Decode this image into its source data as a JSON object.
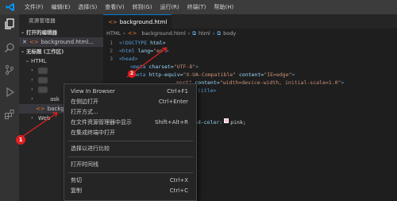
{
  "menu": [
    "文件(F)",
    "编辑(E)",
    "选择(S)",
    "查看(V)",
    "转到(G)",
    "运行(R)",
    "终端(T)",
    "帮助(H)"
  ],
  "sidebar": {
    "title": "资源管理器",
    "open_editors_header": "打开的编辑器",
    "open_file": "background.html...",
    "workspace_header": "无标题 (工作区)",
    "folder": "HTML",
    "items": [
      "",
      "",
      "",
      "ask",
      "backg",
      "Web"
    ],
    "file_badge": "<>"
  },
  "editor": {
    "tab_label": "background.html",
    "breadcrumb": [
      "HTML",
      "background.html",
      "html",
      "body"
    ],
    "line_numbers": [
      "1",
      "2",
      "3"
    ]
  },
  "code": {
    "doctype": "<!DOCTYPE",
    "doctype_rest": " html>",
    "html_open": "<html",
    "lang_attr": " lang=",
    "lang_val": "\"en\"",
    "gt": ">",
    "head_open": "<head>",
    "meta_open": "<meta",
    "charset_attr": " charset=",
    "charset_val": "\"UTF-8\"",
    "meta_close": ">",
    "http_attr": " http-equiv=",
    "http_val": "\"X-UA-Compatible\"",
    "content_attr": " content=",
    "content_val": "\"IE=edge\"",
    "viewport_val": "port\"",
    "content_attr2": " content=",
    "viewport_content": "\"width=device-width, initial-scale=1.0\"",
    "title_close": "/title>",
    "css_prop": "nd-color:",
    "css_value": "pink;"
  },
  "context_menu": {
    "items": [
      {
        "label": "View In Browser",
        "shortcut": "Ctrl+F1"
      },
      {
        "label": "在侧边打开",
        "shortcut": "Ctrl+Enter"
      },
      {
        "label": "打开方式...",
        "shortcut": ""
      },
      {
        "label": "在文件资源管理器中显示",
        "shortcut": "Shift+Alt+R"
      },
      {
        "label": "在集成终端中打开",
        "shortcut": ""
      },
      {
        "label": "选择以进行比较",
        "shortcut": ""
      },
      {
        "label": "打开时间线",
        "shortcut": ""
      },
      {
        "label": "剪切",
        "shortcut": "Ctrl+X"
      },
      {
        "label": "复制",
        "shortcut": "Ctrl+C"
      }
    ]
  },
  "markers": {
    "first": "1",
    "second": "2"
  },
  "colors": {
    "accent": "#0078d4",
    "marker": "#e02020",
    "swatch": "#ffc0cb"
  }
}
